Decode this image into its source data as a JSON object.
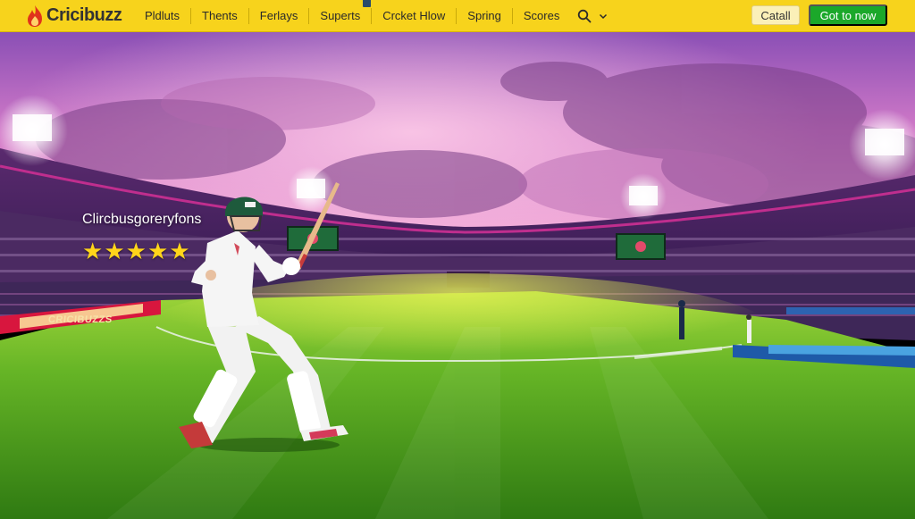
{
  "brand": {
    "name": "Cricibuzz",
    "logo_icon": "flame-icon"
  },
  "nav": {
    "items": [
      {
        "label": "Pldluts"
      },
      {
        "label": "Thents"
      },
      {
        "label": "Ferlays"
      },
      {
        "label": "Superts"
      },
      {
        "label": "Crcket Hlow"
      },
      {
        "label": "Spring"
      },
      {
        "label": "Scores"
      }
    ],
    "search_icon": "search-icon",
    "menu_icon": "chevron-down-icon"
  },
  "actions": {
    "secondary_label": "Catall",
    "primary_label": "Got to now"
  },
  "hero": {
    "title": "Clircbusgoreryfons",
    "rating": {
      "value": 5,
      "max": 5
    },
    "boundary_board_text": "CRICIBUZZS"
  },
  "colors": {
    "topbar": "#f7d31c",
    "primary_button": "#1ba82a",
    "star": "#ffd51a",
    "sky_pink": "#e58ad0",
    "pitch_green": "#5bb524"
  }
}
